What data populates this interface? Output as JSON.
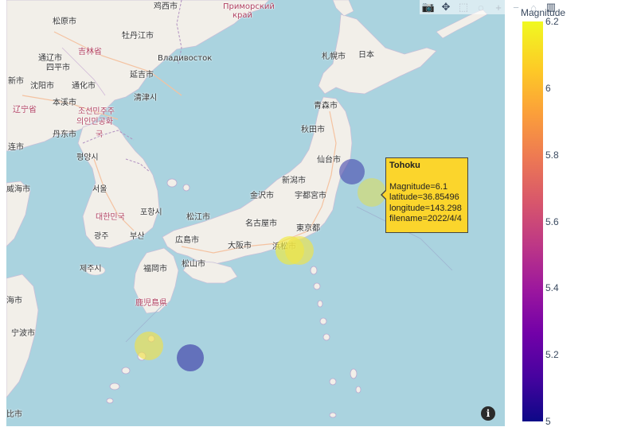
{
  "modebar": {
    "buttons": [
      {
        "name": "camera-icon",
        "glyph": "📷"
      },
      {
        "name": "pan-icon",
        "glyph": "✥"
      },
      {
        "name": "box-select-icon",
        "glyph": "⬚"
      },
      {
        "name": "lasso-icon",
        "glyph": "◌"
      },
      {
        "name": "zoom-in-icon",
        "glyph": "+"
      },
      {
        "name": "zoom-out-icon",
        "glyph": "−"
      },
      {
        "name": "home-icon",
        "glyph": "⌂"
      },
      {
        "name": "plotly-logo-icon",
        "glyph": "▥"
      }
    ]
  },
  "map_labels": [
    {
      "text": "鸡西市",
      "cls": ""
    },
    {
      "text": "Приморский",
      "cls": "red"
    },
    {
      "text": "край",
      "cls": "red"
    },
    {
      "text": "松原市",
      "cls": ""
    },
    {
      "text": "吉林省",
      "cls": "red"
    },
    {
      "text": "牡丹江市",
      "cls": ""
    },
    {
      "text": "通辽市",
      "cls": ""
    },
    {
      "text": "四平市",
      "cls": ""
    },
    {
      "text": "Владивосток",
      "cls": ""
    },
    {
      "text": "札幌市",
      "cls": ""
    },
    {
      "text": "日本",
      "cls": ""
    },
    {
      "text": "新市",
      "cls": ""
    },
    {
      "text": "沈阳市",
      "cls": ""
    },
    {
      "text": "通化市",
      "cls": ""
    },
    {
      "text": "延吉市",
      "cls": ""
    },
    {
      "text": "本溪市",
      "cls": ""
    },
    {
      "text": "清津시",
      "cls": ""
    },
    {
      "text": "辽宁省",
      "cls": "red"
    },
    {
      "text": "조선민주주",
      "cls": "red"
    },
    {
      "text": "의인민공화",
      "cls": "red"
    },
    {
      "text": "青森市",
      "cls": ""
    },
    {
      "text": "丹东市",
      "cls": ""
    },
    {
      "text": "국",
      "cls": "red"
    },
    {
      "text": "秋田市",
      "cls": ""
    },
    {
      "text": "连市",
      "cls": ""
    },
    {
      "text": "평양시",
      "cls": ""
    },
    {
      "text": "仙台市",
      "cls": ""
    },
    {
      "text": "新潟市",
      "cls": ""
    },
    {
      "text": "威海市",
      "cls": ""
    },
    {
      "text": "서울",
      "cls": ""
    },
    {
      "text": "金沢市",
      "cls": ""
    },
    {
      "text": "宇都宮市",
      "cls": ""
    },
    {
      "text": "포항시",
      "cls": ""
    },
    {
      "text": "대한민국",
      "cls": "red"
    },
    {
      "text": "松江市",
      "cls": ""
    },
    {
      "text": "名古屋市",
      "cls": ""
    },
    {
      "text": "東京都",
      "cls": ""
    },
    {
      "text": "광주",
      "cls": ""
    },
    {
      "text": "부산",
      "cls": ""
    },
    {
      "text": "広島市",
      "cls": ""
    },
    {
      "text": "大阪市",
      "cls": ""
    },
    {
      "text": "浜松市",
      "cls": ""
    },
    {
      "text": "松山市",
      "cls": ""
    },
    {
      "text": "제주시",
      "cls": ""
    },
    {
      "text": "福岡市",
      "cls": ""
    },
    {
      "text": "鹿児島県",
      "cls": "red"
    },
    {
      "text": "海市",
      "cls": ""
    },
    {
      "text": "宁波市",
      "cls": ""
    },
    {
      "text": "比市",
      "cls": ""
    }
  ],
  "chart_data": {
    "type": "scatter_mapbox",
    "color_variable": "Magnitude",
    "colorscale": "Plasma",
    "color_range": [
      5,
      6.2
    ],
    "colorbar_ticks": [
      "6.2",
      "6",
      "5.8",
      "5.6",
      "5.4",
      "5.2",
      "5"
    ],
    "points": [
      {
        "name": "Tohoku",
        "latitude": 36.85496,
        "longitude": 143.298,
        "magnitude": 6.1,
        "filename": "2022/4/4",
        "color": "#d7dc6a"
      },
      {
        "latitude": 38.1,
        "longitude": 142.0,
        "magnitude": 5.1,
        "color": "#4b4fb0"
      },
      {
        "latitude": 33.3,
        "longitude": 138.0,
        "magnitude": 6.1,
        "color": "#f0ea3e"
      },
      {
        "latitude": 33.3,
        "longitude": 138.6,
        "magnitude": 6.1,
        "color": "#f0e448"
      },
      {
        "latitude": 27.5,
        "longitude": 128.9,
        "magnitude": 6.1,
        "color": "#f0e04a"
      },
      {
        "latitude": 26.8,
        "longitude": 131.6,
        "magnitude": 5.1,
        "color": "#3e3ca8"
      }
    ]
  },
  "tooltip": {
    "title": "Tohoku",
    "lines": [
      "Magnitude=6.1",
      "latitude=36.85496",
      "longitude=143.298",
      "filename=2022/4/4"
    ]
  },
  "info_button": "i"
}
